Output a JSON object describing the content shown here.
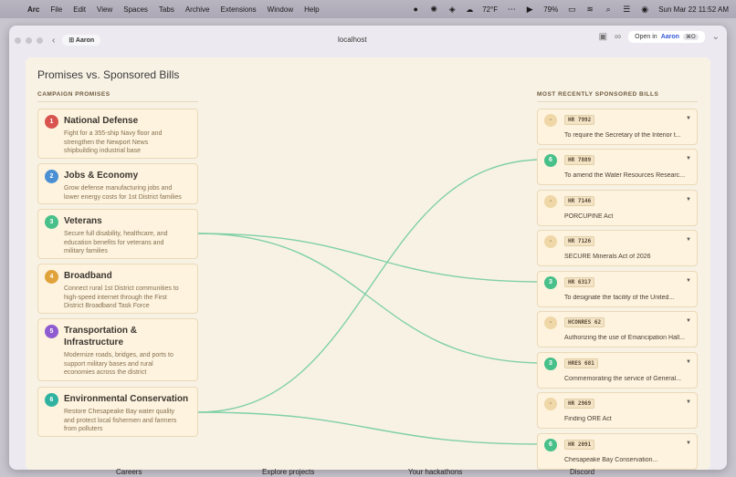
{
  "menubar": {
    "app": "Arc",
    "items": [
      "File",
      "Edit",
      "View",
      "Spaces",
      "Tabs",
      "Archive",
      "Extensions",
      "Window",
      "Help"
    ],
    "weather": "72°F",
    "battery": "79%",
    "clock": "Sun Mar 22  11:52 AM"
  },
  "browser": {
    "profile": "Aaron",
    "url": "localhost",
    "open_in_label": "Open in",
    "open_in_profile": "Aaron",
    "shortcut": "⌘O"
  },
  "page": {
    "title": "Promises vs. Sponsored Bills",
    "promises_heading": "CAMPAIGN PROMISES",
    "bills_heading": "MOST RECENTLY SPONSORED BILLS"
  },
  "colors": {
    "link": "#7fd0a4",
    "match_badge": "#47c08a",
    "promise_badges": [
      "#d9534f",
      "#4a8fd4",
      "#47c08a",
      "#e0a23a",
      "#8e5bd0",
      "#2fb3a0"
    ]
  },
  "promises": [
    {
      "num": "1",
      "title": "National Defense",
      "desc": [
        "Fight for a 355-ship Navy floor and",
        "strengthen the Newport News",
        "shipbuilding industrial base"
      ]
    },
    {
      "num": "2",
      "title": "Jobs & Economy",
      "desc": [
        "Grow defense manufacturing jobs and",
        "lower energy costs for 1st District families"
      ]
    },
    {
      "num": "3",
      "title": "Veterans",
      "desc": [
        "Secure full disability, healthcare, and",
        "education benefits for veterans and",
        "military families"
      ]
    },
    {
      "num": "4",
      "title": "Broadband",
      "desc": [
        "Connect rural 1st District communities to",
        "high-speed internet through the First",
        "District Broadband Task Force"
      ]
    },
    {
      "num": "5",
      "title": "Transportation & Infrastructure",
      "desc": [
        "Modernize roads, bridges, and ports to",
        "support military bases and rural",
        "economies across the district"
      ]
    },
    {
      "num": "6",
      "title": "Environmental Conservation",
      "desc": [
        "Restore Chesapeake Bay water quality",
        "and protect local fishermen and farmers",
        "from polluters"
      ]
    }
  ],
  "bills": [
    {
      "badge": "-",
      "code": "HR 7992",
      "title": "To require the Secretary of the Interior t..."
    },
    {
      "badge": "6",
      "code": "HR 7889",
      "title": "To amend the Water Resources Researc..."
    },
    {
      "badge": "-",
      "code": "HR 7146",
      "title": "PORCUPINE Act"
    },
    {
      "badge": "-",
      "code": "HR 7126",
      "title": "SECURE Minerals Act of 2026"
    },
    {
      "badge": "3",
      "code": "HR 6317",
      "title": "To designate the facility of the United..."
    },
    {
      "badge": "-",
      "code": "HCONRES 62",
      "title": "Authorizing the use of Emancipation Hall..."
    },
    {
      "badge": "3",
      "code": "HRES 681",
      "title": "Commemorating the service of General..."
    },
    {
      "badge": "-",
      "code": "HR 2969",
      "title": "Finding ORE Act"
    },
    {
      "badge": "6",
      "code": "HR 2091",
      "title": "Chesapeake Bay Conservation..."
    }
  ],
  "footer_peek": [
    "Careers",
    "Explore projects",
    "Your hackathons",
    "Discord"
  ]
}
